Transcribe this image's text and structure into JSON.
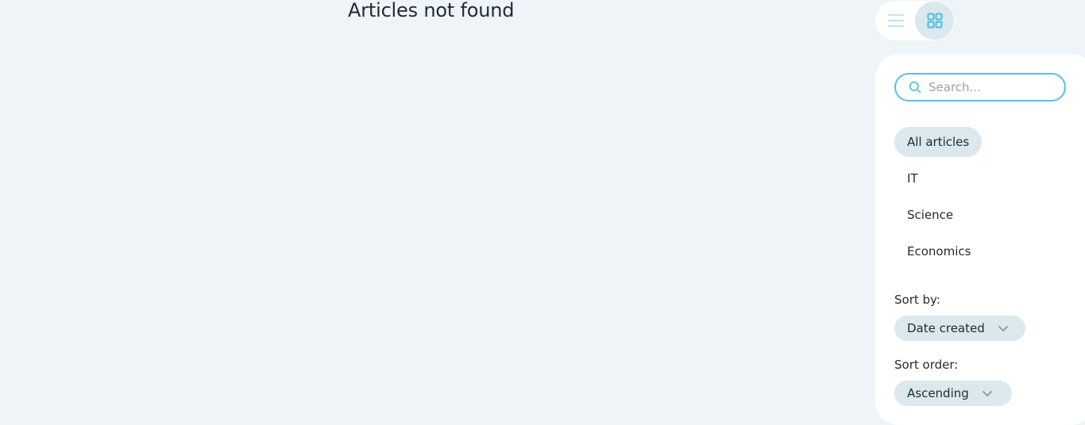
{
  "main": {
    "empty_message": "Articles not found"
  },
  "view_toggle": {
    "list_icon": "list-icon",
    "grid_icon": "grid-icon",
    "active": "grid"
  },
  "search": {
    "placeholder": "Search...",
    "value": "",
    "icon": "search-icon"
  },
  "categories": {
    "items": [
      {
        "label": "All articles",
        "active": true
      },
      {
        "label": "IT",
        "active": false
      },
      {
        "label": "Science",
        "active": false
      },
      {
        "label": "Economics",
        "active": false
      }
    ]
  },
  "sort": {
    "label": "Sort by:",
    "selected": "Date created"
  },
  "order": {
    "label": "Sort order:",
    "selected": "Ascending"
  },
  "colors": {
    "background": "#eef4f7",
    "panel": "#ffffff",
    "accent": "#56c2e0",
    "chip": "#dbe8ed",
    "text": "#1f2a33"
  }
}
